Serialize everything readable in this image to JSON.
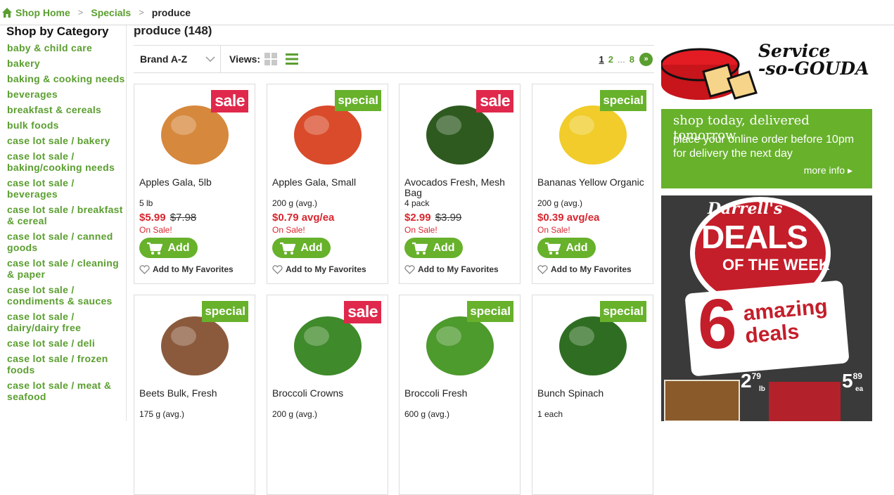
{
  "breadcrumb": {
    "home": "Shop Home",
    "specials": "Specials",
    "current": "produce"
  },
  "sidebar": {
    "title": "Shop by Category",
    "items": [
      {
        "label": "baby & child care"
      },
      {
        "label": "bakery"
      },
      {
        "label": "baking & cooking needs"
      },
      {
        "label": "beverages"
      },
      {
        "label": "breakfast & cereals"
      },
      {
        "label": "bulk foods"
      },
      {
        "label": "case lot sale / bakery"
      },
      {
        "label": "case lot sale / baking/cooking needs"
      },
      {
        "label": "case lot sale / beverages"
      },
      {
        "label": "case lot sale / breakfast & cereal"
      },
      {
        "label": "case lot sale / canned goods"
      },
      {
        "label": "case lot sale / cleaning & paper"
      },
      {
        "label": "case lot sale / condiments & sauces"
      },
      {
        "label": "case lot sale / dairy/dairy free"
      },
      {
        "label": "case lot sale / deli"
      },
      {
        "label": "case lot sale / frozen foods"
      },
      {
        "label": "case lot sale / meat & seafood"
      }
    ]
  },
  "main": {
    "heading": "produce (148)",
    "sort_label": "Brand A-Z",
    "views_label": "Views:",
    "pagination": {
      "page1": "1",
      "page2": "2",
      "ellipsis": "...",
      "last": "8",
      "next": "»"
    },
    "add_label": "Add",
    "fav_label": "Add to My Favorites",
    "products": [
      {
        "name": "Apples Gala, 5lb",
        "badge": "sale",
        "size": "5 lb",
        "price": "$5.99",
        "old_price": "$7.98",
        "on_sale": "On Sale!",
        "color": "#d6883c"
      },
      {
        "name": "Apples Gala, Small",
        "badge": "special",
        "size": "200 g (avg.)",
        "price": "$0.79 avg/ea",
        "old_price": "",
        "on_sale": "On Sale!",
        "color": "#d94b2a"
      },
      {
        "name": "Avocados Fresh, Mesh Bag",
        "badge": "sale",
        "size": "4 pack",
        "price": "$2.99",
        "old_price": "$3.99",
        "on_sale": "On Sale!",
        "color": "#2e5a1f"
      },
      {
        "name": "Bananas Yellow Organic",
        "badge": "special",
        "size": "200 g (avg.)",
        "price": "$0.39 avg/ea",
        "old_price": "",
        "on_sale": "On Sale!",
        "color": "#f1cc2a"
      },
      {
        "name": "Beets Bulk, Fresh",
        "badge": "special",
        "size": "175 g (avg.)",
        "price": "",
        "old_price": "",
        "on_sale": "",
        "color": "#8b5a3c"
      },
      {
        "name": "Broccoli Crowns",
        "badge": "sale",
        "size": "200 g (avg.)",
        "price": "",
        "old_price": "",
        "on_sale": "",
        "color": "#3f8a2a"
      },
      {
        "name": "Broccoli Fresh",
        "badge": "special",
        "size": "600 g (avg.)",
        "price": "",
        "old_price": "",
        "on_sale": "",
        "color": "#4d9a2d"
      },
      {
        "name": "Bunch Spinach",
        "badge": "special",
        "size": "1 each",
        "price": "",
        "old_price": "",
        "on_sale": "",
        "color": "#2f6e22"
      }
    ]
  },
  "ad1": {
    "brand_line1": "Service",
    "brand_line2": "-so-GOUDA",
    "headline": "shop today, delivered tomorrow",
    "body": "place your online order before 10pm for delivery the next day",
    "more": "more info ▸",
    "color": "#67b12b"
  },
  "ad2": {
    "title_top": "Darrell's",
    "title_main": "DEALS",
    "title_sub": "OF THE WEEK",
    "count": "6",
    "tagline": "amazing deals",
    "price1_main": "2",
    "price1_sup": "79",
    "price1_unit": "lb",
    "price2_main": "5",
    "price2_sup": "89",
    "price2_unit": "ea"
  }
}
